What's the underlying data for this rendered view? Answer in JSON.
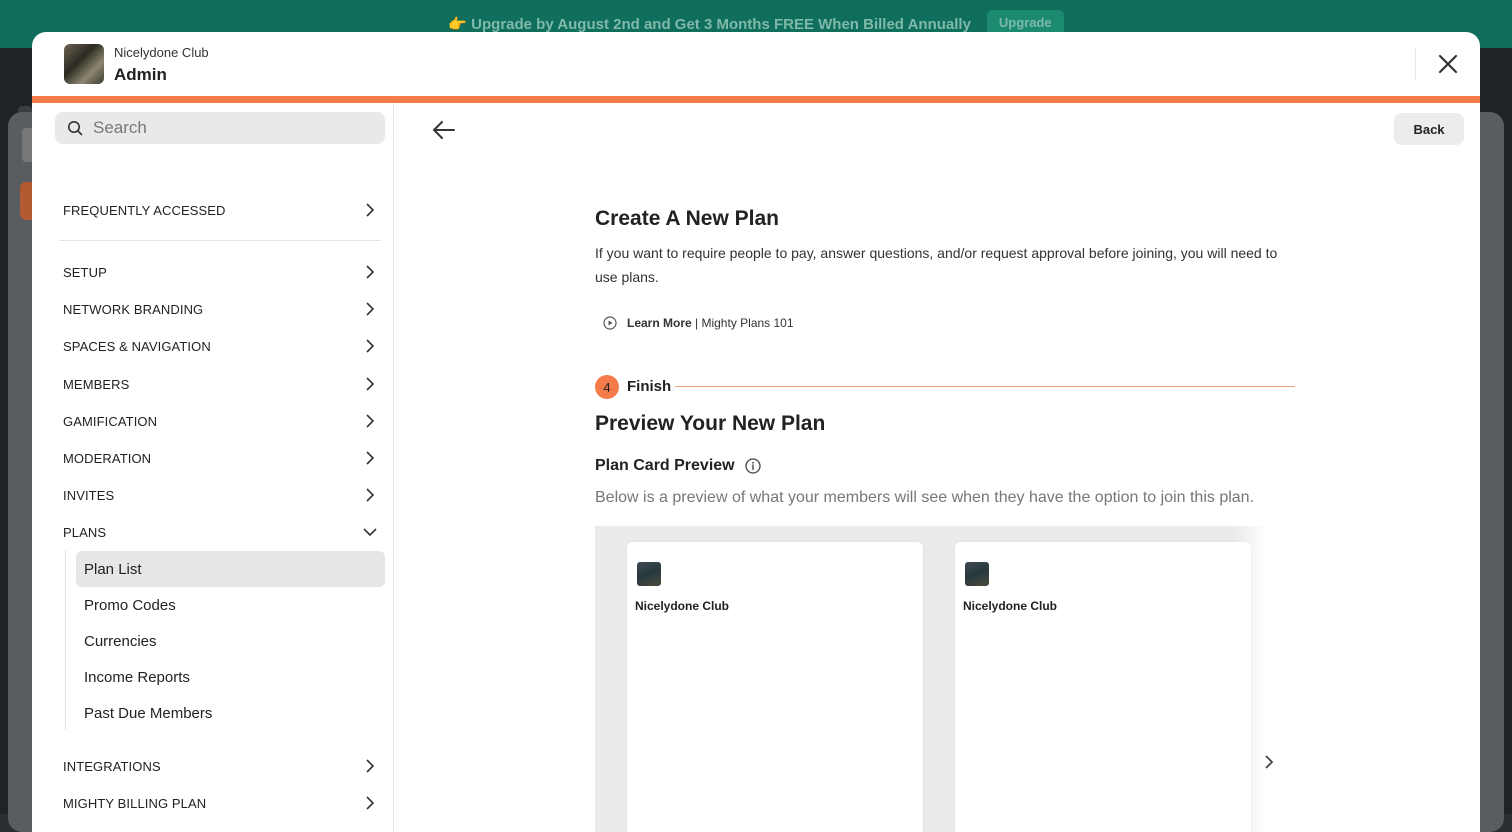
{
  "banner": {
    "text": "👉 Upgrade by August 2nd and Get 3 Months FREE When Billed Annually",
    "button_label": "Upgrade"
  },
  "header": {
    "network_name": "Nicelydone Club",
    "title": "Admin"
  },
  "sidebar": {
    "search_placeholder": "Search",
    "items": [
      {
        "label": "FREQUENTLY ACCESSED"
      },
      {
        "label": "SETUP"
      },
      {
        "label": "NETWORK BRANDING"
      },
      {
        "label": "SPACES & NAVIGATION"
      },
      {
        "label": "MEMBERS"
      },
      {
        "label": "GAMIFICATION"
      },
      {
        "label": "MODERATION"
      },
      {
        "label": "INVITES"
      },
      {
        "label": "PLANS"
      },
      {
        "label": "INTEGRATIONS"
      },
      {
        "label": "MIGHTY BILLING PLAN"
      }
    ],
    "plans_subitems": [
      {
        "label": "Plan List"
      },
      {
        "label": "Promo Codes"
      },
      {
        "label": "Currencies"
      },
      {
        "label": "Income Reports"
      },
      {
        "label": "Past Due Members"
      }
    ]
  },
  "main": {
    "back_label": "Back",
    "title": "Create A New Plan",
    "description": "If you want to require people to pay, answer questions, and/or request approval before joining, you will need to use plans.",
    "learn_more_label": "Learn More",
    "learn_more_suffix": " | Mighty Plans 101",
    "step": {
      "number": "4",
      "label": "Finish"
    },
    "preview_title": "Preview Your New Plan",
    "card_preview_title": "Plan Card Preview",
    "card_preview_desc": "Below is a preview of what your members will see when they have the option to join this plan.",
    "cards": [
      {
        "name": "Nicelydone Club"
      },
      {
        "name": "Nicelydone Club"
      }
    ]
  },
  "colors": {
    "accent": "#f47c4a",
    "banner": "#0f6e5c"
  }
}
